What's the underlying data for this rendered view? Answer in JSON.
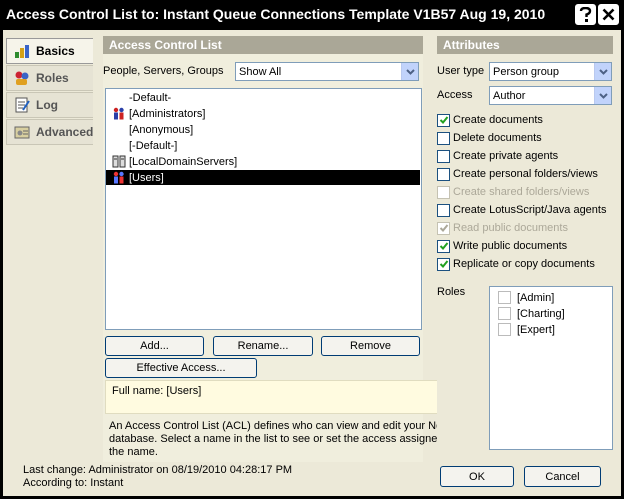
{
  "window": {
    "title": "Access Control List to: Instant Queue Connections Template V1B57 Aug 19, 2010",
    "help_icon": "help-icon",
    "close_icon": "close-icon"
  },
  "tabs": [
    {
      "label": "Basics",
      "icon": "basics-icon",
      "active": true
    },
    {
      "label": "Roles",
      "icon": "roles-icon",
      "active": false
    },
    {
      "label": "Log",
      "icon": "log-icon",
      "active": false
    },
    {
      "label": "Advanced",
      "icon": "advanced-icon",
      "active": false
    }
  ],
  "acl": {
    "header": "Access Control List",
    "filter_label": "People, Servers, Groups",
    "filter_value": "Show All",
    "entries": [
      {
        "name": "-Default-",
        "icon": "none",
        "selected": false
      },
      {
        "name": "[Administrators]",
        "icon": "person-group-icon",
        "selected": false
      },
      {
        "name": "[Anonymous]",
        "icon": "none",
        "selected": false
      },
      {
        "name": "[-Default-]",
        "icon": "none",
        "selected": false
      },
      {
        "name": "[LocalDomainServers]",
        "icon": "server-group-icon",
        "selected": false
      },
      {
        "name": "[Users]",
        "icon": "person-group-icon",
        "selected": true
      }
    ],
    "buttons": {
      "add": "Add...",
      "rename": "Rename...",
      "remove": "Remove",
      "effective_access": "Effective Access..."
    },
    "full_name": "Full name: [Users]",
    "description": "An Access Control List (ACL) defines who can view and edit your Notes database.  Select a name in the list to see or set the access assigned to the name."
  },
  "attributes": {
    "header": "Attributes",
    "user_type_label": "User type",
    "user_type_value": "Person group",
    "access_label": "Access",
    "access_value": "Author",
    "options": [
      {
        "label": "Create documents",
        "checked": true,
        "disabled": false
      },
      {
        "label": "Delete documents",
        "checked": false,
        "disabled": false
      },
      {
        "label": "Create private agents",
        "checked": false,
        "disabled": false
      },
      {
        "label": "Create personal folders/views",
        "checked": false,
        "disabled": false
      },
      {
        "label": "Create shared folders/views",
        "checked": false,
        "disabled": true
      },
      {
        "label": "Create LotusScript/Java agents",
        "checked": false,
        "disabled": false
      },
      {
        "label": "Read public documents",
        "checked": true,
        "disabled": true
      },
      {
        "label": "Write public documents",
        "checked": true,
        "disabled": false
      },
      {
        "label": "Replicate or copy documents",
        "checked": true,
        "disabled": false
      }
    ],
    "roles_label": "Roles",
    "roles": [
      {
        "name": "[Admin]",
        "checked": false
      },
      {
        "name": "[Charting]",
        "checked": false
      },
      {
        "name": "[Expert]",
        "checked": false
      }
    ]
  },
  "footer": {
    "last_change": "Last change: Administrator on 08/19/2010 04:28:17 PM",
    "according_to": "According to: Instant",
    "ok": "OK",
    "cancel": "Cancel"
  },
  "colors": {
    "titlebar": "#000000",
    "dialog_bg": "#ece9d8",
    "section_header": "#aaa797",
    "selection": "#000000",
    "check_green": "#21a121"
  }
}
